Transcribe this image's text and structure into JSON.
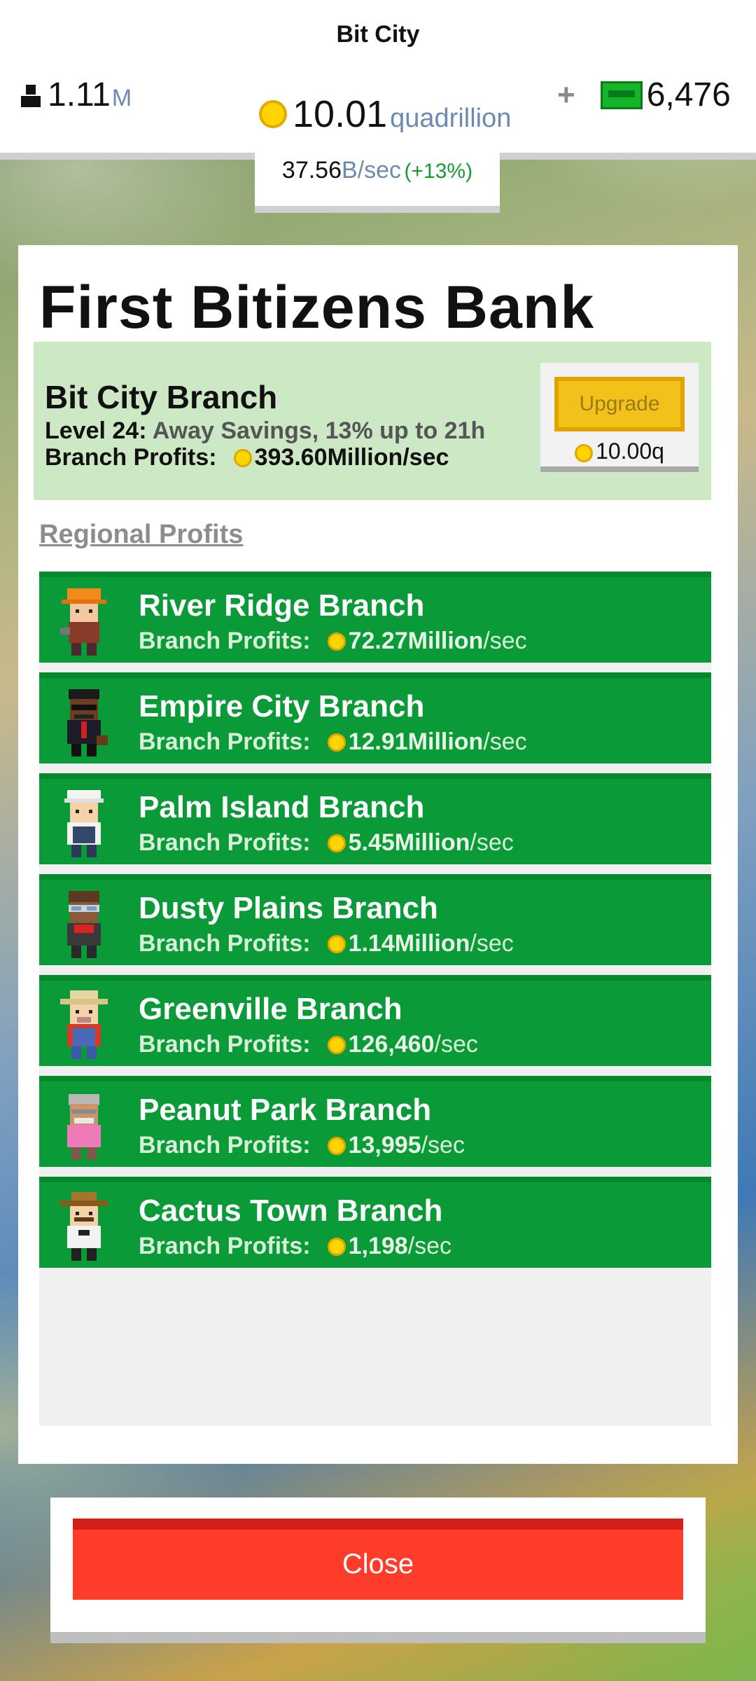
{
  "topbar": {
    "city_name": "Bit City",
    "population_value": "1.11",
    "population_unit": "M",
    "coins_value": "10.01",
    "coins_unit": "quadrillion",
    "plus_label": "+",
    "cash_value": "6,476",
    "rate_value": "37.56",
    "rate_unit": "B/sec",
    "rate_bonus": "(+13%)"
  },
  "panel": {
    "title": "First Bitizens Bank",
    "main_branch": {
      "name": "Bit City Branch",
      "level_label": "Level 24:",
      "level_desc": "Away Savings, 13% up to 21h",
      "profits_label": "Branch Profits:",
      "profits_value": "393.60Million/sec",
      "upgrade_label": "Upgrade",
      "upgrade_cost": "10.00q"
    },
    "regional_title": "Regional Profits",
    "branches": [
      {
        "name": "River Ridge Branch",
        "label": "Branch Profits:",
        "value": "72.27Million",
        "per": "/sec"
      },
      {
        "name": "Empire City Branch",
        "label": "Branch Profits:",
        "value": "12.91Million",
        "per": "/sec"
      },
      {
        "name": "Palm Island Branch",
        "label": "Branch Profits:",
        "value": "5.45Million",
        "per": "/sec"
      },
      {
        "name": "Dusty Plains Branch",
        "label": "Branch Profits:",
        "value": "1.14Million",
        "per": "/sec"
      },
      {
        "name": "Greenville Branch",
        "label": "Branch Profits:",
        "value": "126,460",
        "per": "/sec"
      },
      {
        "name": "Peanut Park Branch",
        "label": "Branch Profits:",
        "value": "13,995",
        "per": "/sec"
      },
      {
        "name": "Cactus Town Branch",
        "label": "Branch Profits:",
        "value": "1,198",
        "per": "/sec"
      }
    ]
  },
  "close_label": "Close",
  "colors": {
    "branch_green": "#0a9b38",
    "main_branch_bg": "#cde8c4",
    "close_red": "#ff3b2a",
    "coin_yellow": "#ffd400"
  }
}
